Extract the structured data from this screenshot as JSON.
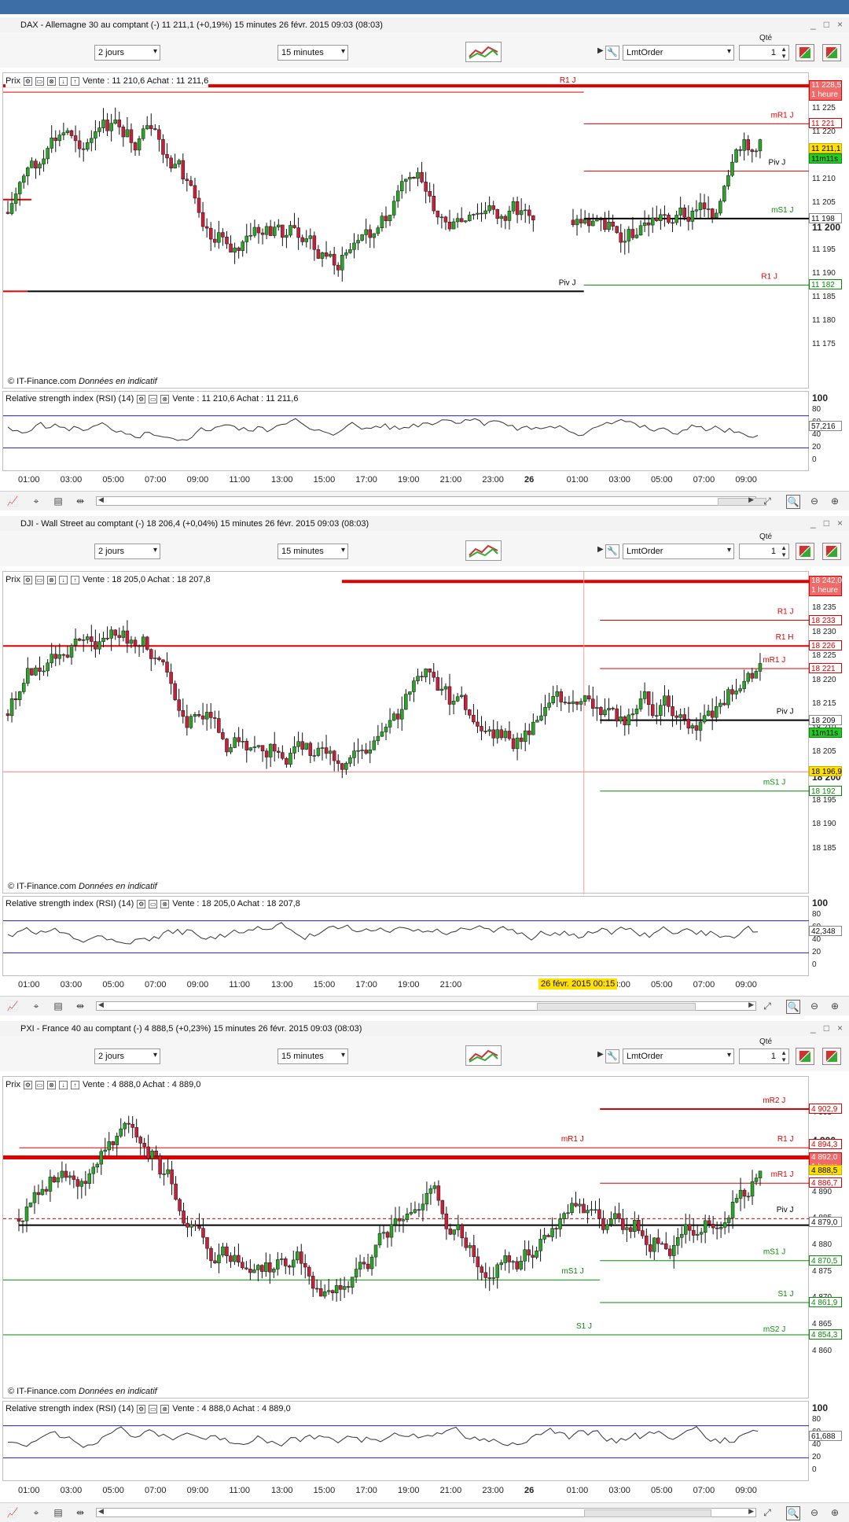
{
  "colors": {
    "bull": "#2aa52a",
    "bear": "#c8203a",
    "resistance": "#e00000",
    "support": "#0a8a0a",
    "pivot": "#000000",
    "rsi_line": "#333333",
    "rsi_band": "#2222aa"
  },
  "common": {
    "period": "2 jours",
    "interval": "15 minutes",
    "order_type": "LmtOrder",
    "qty_label": "Qté",
    "qty_value": "1",
    "price_legend": "Prix",
    "rsi_title": "Relative strength index (RSI) (14)",
    "copyright_prefix": "© IT-Finance.com",
    "copyright_italic": "Données en indicatif",
    "rsi_ticks": [
      "100",
      "80",
      "60",
      "40",
      "20",
      "0"
    ],
    "window_buttons": [
      "_",
      "□",
      "×"
    ],
    "toolbar_icons": [
      "wrench-icon",
      "chart-type-icon"
    ],
    "bottom_icons": [
      "chart-icon",
      "cursor-icon",
      "table-icon",
      "split-icon",
      "zoom-fit-icon",
      "zoom-out-icon",
      "zoom-in-icon"
    ]
  },
  "panels": [
    {
      "title": "DAX - Allemagne 30 au comptant (-)   11 211,1 (+0,19%)   15 minutes  26 févr. 2015 09:03 (08:03)",
      "quote": "Vente : 11 210,6 Achat : 11 211,6",
      "rsi_value": "57,216",
      "y_ticks": [
        "11 225",
        "11 220",
        "11 215",
        "11 210",
        "11 205",
        "11 200",
        "11 195",
        "11 190",
        "11 185",
        "11 180",
        "11 175"
      ],
      "big_tick": "11 200",
      "tags": [
        {
          "text": "11 228,5",
          "sub": "1 heure",
          "kind": "redfill"
        },
        {
          "text": "11 221",
          "kind": "red"
        },
        {
          "text": "11 211,1",
          "kind": "yellow"
        },
        {
          "text": "11m11s",
          "kind": "greenfill"
        },
        {
          "text": "11 198",
          "kind": "gray"
        },
        {
          "text": "11 182",
          "kind": "green"
        }
      ],
      "level_labels": [
        "R1 J",
        "mR1 J",
        "Piv J",
        "mS1 J",
        "R1 J",
        "Piv J"
      ],
      "x_ticks": [
        "01:00",
        "03:00",
        "05:00",
        "07:00",
        "09:00",
        "11:00",
        "13:00",
        "15:00",
        "17:00",
        "19:00",
        "21:00",
        "23:00",
        "26",
        "01:00",
        "03:00",
        "05:00",
        "07:00",
        "09:00"
      ],
      "x_highlight": ""
    },
    {
      "title": "DJI - Wall Street au comptant (-)   18 206,4 (+0,04%)   15 minutes  26 févr. 2015 09:03 (08:03)",
      "quote": "Vente : 18 205,0 Achat : 18 207,8",
      "rsi_value": "42,348",
      "y_ticks": [
        "18 235",
        "18 230",
        "18 225",
        "18 220",
        "18 215",
        "18 210",
        "18 205",
        "18 200",
        "18 195",
        "18 190",
        "18 185"
      ],
      "big_tick": "18 200",
      "tags": [
        {
          "text": "18 242,0",
          "sub": "1 heure",
          "kind": "redfill"
        },
        {
          "text": "18 233",
          "kind": "red"
        },
        {
          "text": "18 226",
          "kind": "red"
        },
        {
          "text": "18 221",
          "kind": "red"
        },
        {
          "text": "18 209",
          "kind": "gray"
        },
        {
          "text": "11m11s",
          "kind": "greenfill"
        },
        {
          "text": "18 196,9",
          "kind": "yellow"
        },
        {
          "text": "18 192",
          "kind": "green"
        }
      ],
      "level_labels": [
        "R1 J",
        "R1 H",
        "mR1 J",
        "Piv J",
        "mS1 J"
      ],
      "x_ticks": [
        "01:00",
        "03:00",
        "05:00",
        "07:00",
        "09:00",
        "11:00",
        "13:00",
        "15:00",
        "17:00",
        "19:00",
        "21:00",
        "03:00",
        "05:00",
        "07:00",
        "09:00"
      ],
      "x_highlight": "26 févr. 2015 00:15"
    },
    {
      "title": "PXI - France 40 au comptant (-)   4 888,5 (+0,23%)   15 minutes  26 févr. 2015 09:03 (08:03)",
      "quote": "Vente : 4 888,0 Achat : 4 889,0",
      "rsi_value": "61,688",
      "y_ticks": [
        "4 905",
        "4 900",
        "4 895",
        "4 890",
        "4 885",
        "4 880",
        "4 875",
        "4 870",
        "4 865",
        "4 860"
      ],
      "big_tick": "4 900",
      "tags": [
        {
          "text": "4 902,9",
          "kind": "red"
        },
        {
          "text": "4 894,3",
          "kind": "red"
        },
        {
          "text": "4 892,0",
          "sub": "1 heure",
          "kind": "redfill"
        },
        {
          "text": "4 888,5",
          "kind": "yellow"
        },
        {
          "text": "4 886,7",
          "kind": "red"
        },
        {
          "text": "4 879,0",
          "kind": "gray"
        },
        {
          "text": "4 870,5",
          "kind": "green"
        },
        {
          "text": "4 861,9",
          "kind": "green"
        },
        {
          "text": "4 854,3",
          "kind": "green"
        }
      ],
      "level_labels": [
        "mR2 J",
        "R1 J",
        "mR1 J",
        "mR1 J",
        "Piv J",
        "mS1 J",
        "mS1 J",
        "S1 J",
        "S1 J",
        "mS2 J"
      ],
      "x_ticks": [
        "01:00",
        "03:00",
        "05:00",
        "07:00",
        "09:00",
        "11:00",
        "13:00",
        "15:00",
        "17:00",
        "19:00",
        "21:00",
        "23:00",
        "26",
        "01:00",
        "03:00",
        "05:00",
        "07:00",
        "09:00"
      ],
      "x_highlight": ""
    }
  ]
}
